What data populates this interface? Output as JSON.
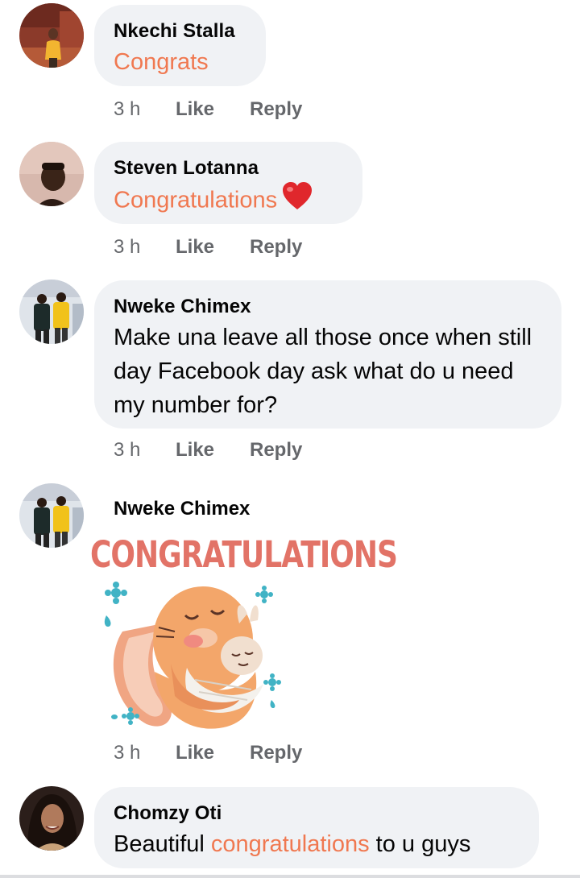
{
  "comments": [
    {
      "name": "Nkechi Stalla",
      "text_parts": [
        "Congrats"
      ],
      "time": "3 h",
      "like": "Like",
      "reply": "Reply"
    },
    {
      "name": "Steven Lotanna",
      "text_parts": [
        "Congratulations"
      ],
      "time": "3 h",
      "like": "Like",
      "reply": "Reply"
    },
    {
      "name": "Nweke Chimex",
      "text": "Make una leave all those once when still day Facebook day ask what do u need my number for?",
      "time": "3 h",
      "like": "Like",
      "reply": "Reply"
    },
    {
      "name": "Nweke Chimex",
      "sticker_title": "CONGRATULATIONS",
      "time": "3 h",
      "like": "Like",
      "reply": "Reply"
    },
    {
      "name": "Chomzy Oti",
      "text_before": "Beautiful",
      "text_highlight": "congratulations",
      "text_after": "to u guys"
    }
  ],
  "colors": {
    "bubble": "#f0f2f5",
    "highlight": "#f07850",
    "meta": "#65676b",
    "heart": "#e0272c"
  },
  "icons": [
    "heart-emoji-icon"
  ]
}
